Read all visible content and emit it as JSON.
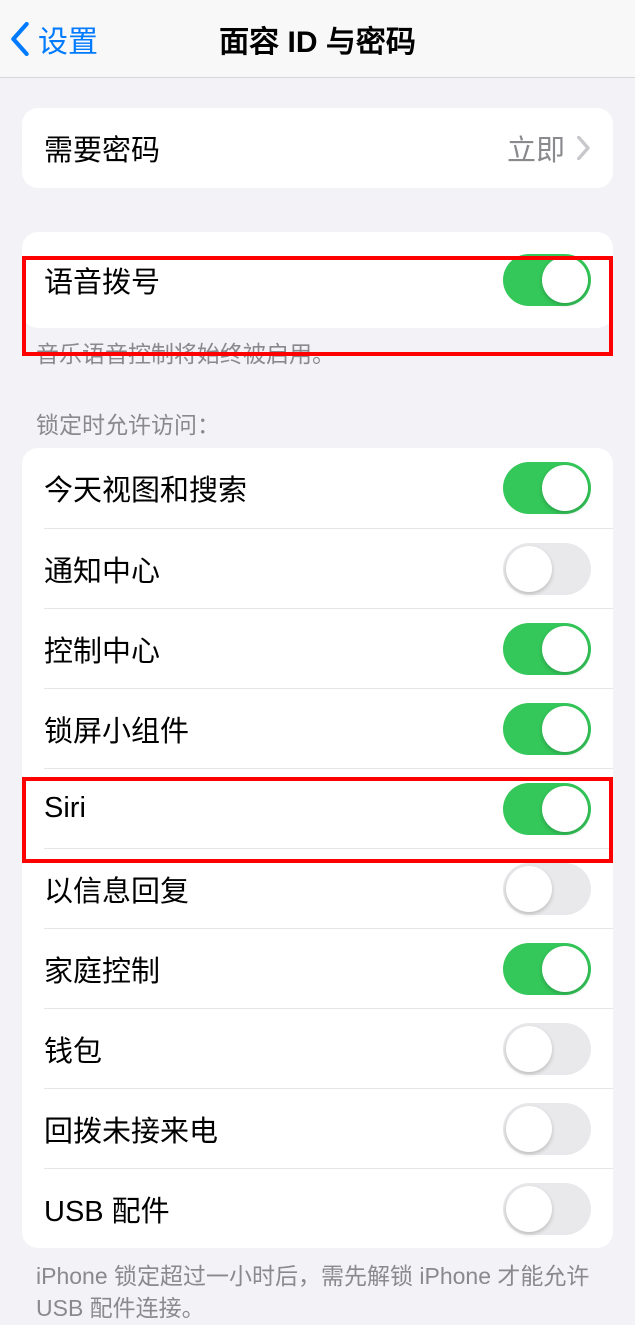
{
  "nav": {
    "back_label": "设置",
    "title": "面容 ID 与密码"
  },
  "group1": {
    "require_passcode_label": "需要密码",
    "require_passcode_value": "立即"
  },
  "group2": {
    "voice_dial_label": "语音拨号",
    "voice_dial_on": true,
    "footer": "音乐语音控制将始终被启用。"
  },
  "group3": {
    "header": "锁定时允许访问：",
    "items": [
      {
        "label": "今天视图和搜索",
        "on": true
      },
      {
        "label": "通知中心",
        "on": false
      },
      {
        "label": "控制中心",
        "on": true
      },
      {
        "label": "锁屏小组件",
        "on": true
      },
      {
        "label": "Siri",
        "on": true
      },
      {
        "label": "以信息回复",
        "on": false
      },
      {
        "label": "家庭控制",
        "on": true
      },
      {
        "label": "钱包",
        "on": false
      },
      {
        "label": "回拨未接来电",
        "on": false
      },
      {
        "label": "USB 配件",
        "on": false
      }
    ],
    "footer": "iPhone 锁定超过一小时后，需先解锁 iPhone 才能允许USB 配件连接。"
  }
}
